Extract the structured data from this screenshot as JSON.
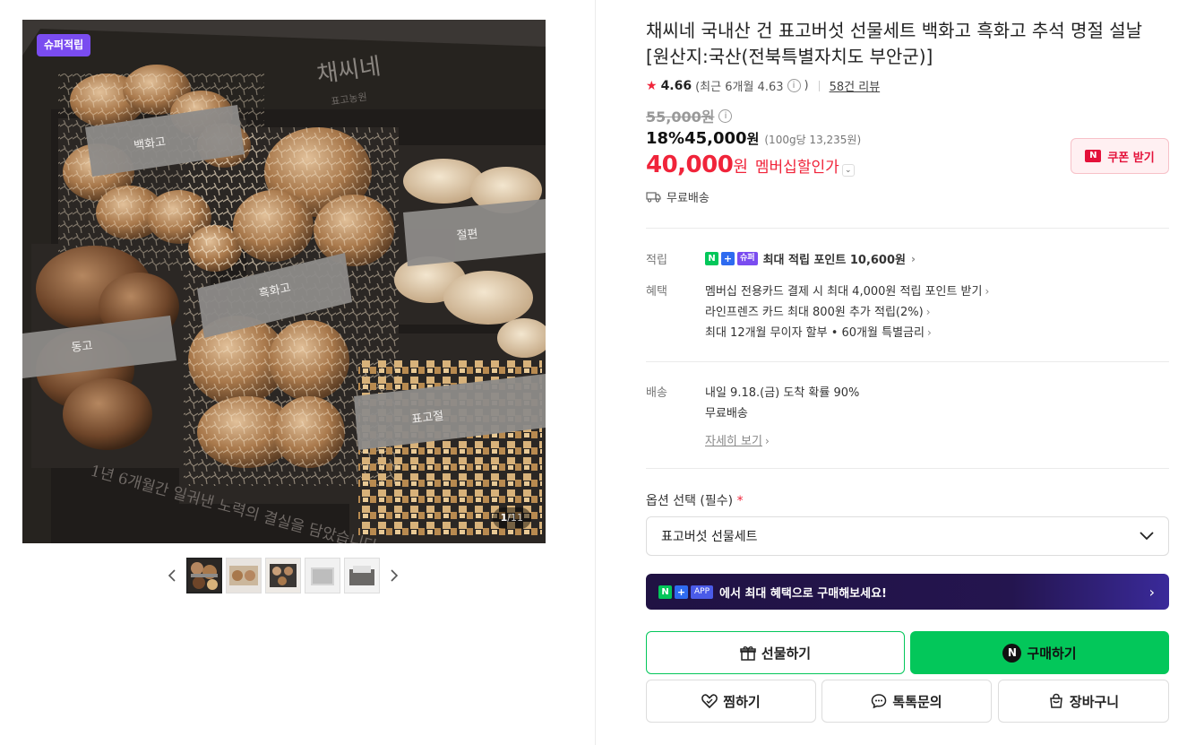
{
  "gallery": {
    "badge": "슈퍼적립",
    "counter_current": "1",
    "counter_total": "/11",
    "thumbnails": 5
  },
  "product": {
    "title_line1": "채씨네 국내산 건 표고버섯 선물세트 백화고 흑화고 추석 명절 설날",
    "title_line2": "[원산지:국산(전북특별자치도 부안군)]",
    "rating": "4.66",
    "rating_recent": "(최근 6개월 4.63",
    "rating_recent_close": ")",
    "review_count": "58건 리뷰",
    "original_price": "55,000원",
    "discount_rate": "18%",
    "sale_price": "45,000",
    "won": "원",
    "unit_price": "(100g당 13,235원)",
    "member_price": "40,000",
    "member_label": "멤버십할인가",
    "coupon_button": "쿠폰 받기",
    "shipping_free": "무료배송"
  },
  "benefits": {
    "point_label": "적립",
    "point_super": "슈퍼",
    "point_text": "최대 적립 포인트 10,600원",
    "benefit_label": "혜택",
    "benefit_items": [
      "멤버십 전용카드 결제 시 최대 4,000원 적립 포인트 받기",
      "라인프렌즈 카드 최대 800원 추가 적립(2%)",
      "최대 12개월 무이자 할부 • 60개월 특별금리"
    ],
    "delivery_label": "배송",
    "delivery_eta": "내일 9.18.(금) 도착 확률 90%",
    "delivery_free": "무료배송",
    "delivery_detail": "자세히 보기"
  },
  "options": {
    "label": "옵션 선택 (필수)",
    "required_mark": "*",
    "selected": "표고버섯 선물세트"
  },
  "app_banner": {
    "app_tag": "APP",
    "text": "에서 최대 혜택으로 구매해보세요!"
  },
  "actions": {
    "gift": "선물하기",
    "buy": "구매하기",
    "wish": "찜하기",
    "talk": "톡톡문의",
    "cart": "장바구니"
  },
  "colors": {
    "accent_green": "#03c75a",
    "sale_red": "#f0243a",
    "super_purple": "#7a4cf0"
  }
}
